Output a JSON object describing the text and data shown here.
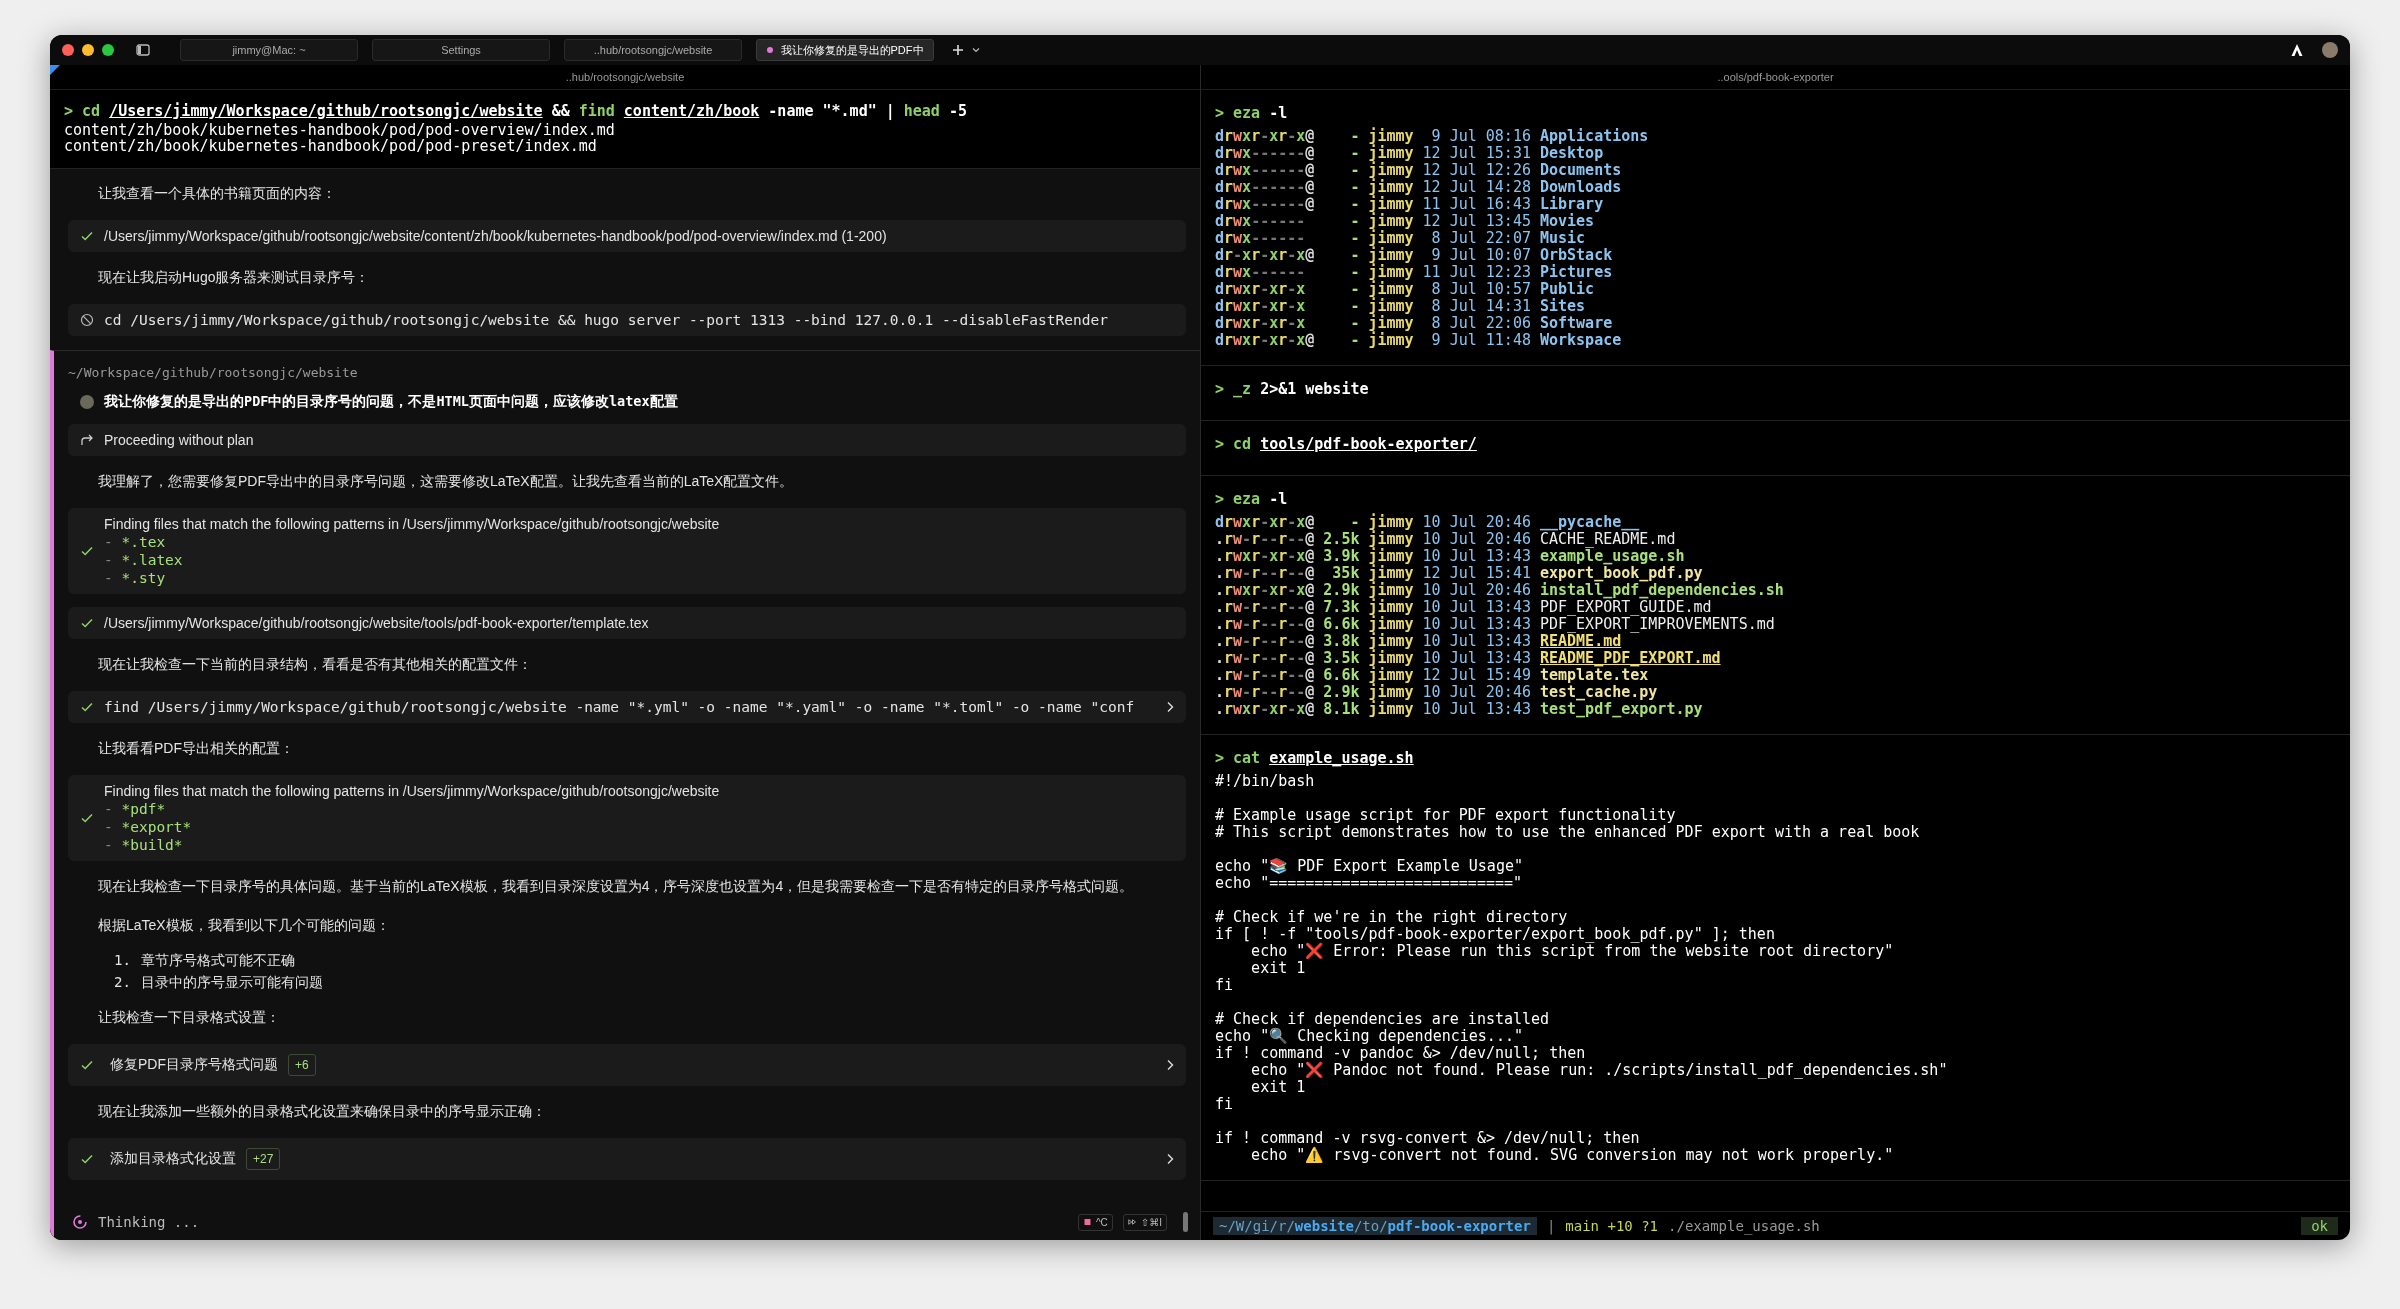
{
  "window": {
    "tabs": [
      {
        "label": "jimmy@Mac: ~",
        "selected": false
      },
      {
        "label": "Settings",
        "selected": false
      },
      {
        "label": "..hub/rootsongjc/website",
        "selected": false
      },
      {
        "label": "我让你修复的是导出的PDF中",
        "selected": true,
        "color": "#e07ad8"
      }
    ]
  },
  "left_pane": {
    "header": "..hub/rootsongjc/website",
    "command": {
      "prompt": ">",
      "segments": [
        {
          "text": "cd",
          "kind": "cmd"
        },
        {
          "text": "/Users/jimmy/Workspace/github/rootsongjc/website",
          "kind": "path"
        },
        {
          "text": "&&",
          "kind": "arg"
        },
        {
          "text": "find",
          "kind": "cmd"
        },
        {
          "text": "content/zh/book",
          "kind": "path"
        },
        {
          "text": "-name \"*.md\" |",
          "kind": "arg"
        },
        {
          "text": "head",
          "kind": "cmd"
        },
        {
          "text": "-5",
          "kind": "arg"
        }
      ]
    },
    "output": [
      "content/zh/book/kubernetes-handbook/pod/pod-overview/index.md",
      "content/zh/book/kubernetes-handbook/pod/pod-preset/index.md"
    ],
    "agent": {
      "sections": [
        {
          "highlighted": false,
          "items": [
            {
              "kind": "note",
              "text": "让我查看一个具体的书籍页面的内容："
            },
            {
              "kind": "file",
              "text": "/Users/jimmy/Workspace/github/rootsongjc/website/content/zh/book/kubernetes-handbook/pod/pod-overview/index.md (1-200)"
            },
            {
              "kind": "note",
              "text": "现在让我启动Hugo服务器来测试目录序号："
            },
            {
              "kind": "cancelled",
              "text": "cd /Users/jimmy/Workspace/github/rootsongjc/website && hugo server --port 1313 --bind 127.0.0.1 --disableFastRender"
            }
          ]
        },
        {
          "highlighted": true,
          "items": [
            {
              "kind": "path",
              "text": "~/Workspace/github/rootsongjc/website"
            },
            {
              "kind": "user",
              "text": "我让你修复的是导出的PDF中的目录序号的问题，不是HTML页面中问题，应该修改latex配置"
            },
            {
              "kind": "plan",
              "text": "Proceeding without plan"
            },
            {
              "kind": "note",
              "text": "我理解了，您需要修复PDF导出中的目录序号问题，这需要修改LaTeX配置。让我先查看当前的LaTeX配置文件。"
            },
            {
              "kind": "search",
              "text": "Finding files that match the following patterns in /Users/jimmy/Workspace/github/rootsongjc/website",
              "patterns": [
                "- *.tex",
                "- *.latex",
                "- *.sty"
              ]
            },
            {
              "kind": "file",
              "text": "/Users/jimmy/Workspace/github/rootsongjc/website/tools/pdf-book-exporter/template.tex"
            },
            {
              "kind": "note",
              "text": "现在让我检查一下当前的目录结构，看看是否有其他相关的配置文件："
            },
            {
              "kind": "command",
              "text": "find /Users/jimmy/Workspace/github/rootsongjc/website -name \"*.yml\" -o -name \"*.yaml\" -o -name \"*.toml\" -o -name \"conf"
            },
            {
              "kind": "note",
              "text": "让我看看PDF导出相关的配置："
            },
            {
              "kind": "search",
              "text": "Finding files that match the following patterns in /Users/jimmy/Workspace/github/rootsongjc/website",
              "patterns": [
                "- *pdf*",
                "- *export*",
                "- *build*"
              ]
            },
            {
              "kind": "note",
              "text": "现在让我检查一下目录序号的具体问题。基于当前的LaTeX模板，我看到目录深度设置为4，序号深度也设置为4，但是我需要检查一下是否有特定的目录序号格式问题。"
            },
            {
              "kind": "note",
              "text": "根据LaTeX模板，我看到以下几个可能的问题："
            },
            {
              "kind": "list",
              "entries": [
                {
                  "number": "1.",
                  "text": "章节序号格式可能不正确"
                },
                {
                  "number": "2.",
                  "text": "目录中的序号显示可能有问题"
                }
              ]
            },
            {
              "kind": "note",
              "text": "让我检查一下目录格式设置："
            },
            {
              "kind": "edit",
              "text": "修复PDF目录序号格式问题",
              "badge": "+6"
            },
            {
              "kind": "note",
              "text": "现在让我添加一些额外的目录格式化设置来确保目录中的序号显示正确："
            },
            {
              "kind": "edit",
              "text": "添加目录格式化设置",
              "badge": "+27"
            }
          ]
        }
      ]
    },
    "footer": {
      "status": "Thinking ...",
      "keys": [
        "^C",
        "⇧⌘I"
      ]
    }
  },
  "right_pane": {
    "header": "..ools/pdf-book-exporter",
    "blocks": [
      {
        "command": {
          "prompt": ">",
          "segments": [
            {
              "text": "eza",
              "kind": "cmd"
            },
            {
              "text": "-l",
              "kind": "arg"
            }
          ]
        },
        "listing": [
          {
            "perms": "drwxr-xr-x@",
            "size": "-",
            "user": "jimmy",
            "date": "9 Jul 08:16",
            "name": "Applications",
            "kind": "dir"
          },
          {
            "perms": "drwx------@",
            "size": "-",
            "user": "jimmy",
            "date": "12 Jul 15:31",
            "name": "Desktop",
            "kind": "dir"
          },
          {
            "perms": "drwx------@",
            "size": "-",
            "user": "jimmy",
            "date": "12 Jul 12:26",
            "name": "Documents",
            "kind": "dir"
          },
          {
            "perms": "drwx------@",
            "size": "-",
            "user": "jimmy",
            "date": "12 Jul 14:28",
            "name": "Downloads",
            "kind": "dir"
          },
          {
            "perms": "drwx------@",
            "size": "-",
            "user": "jimmy",
            "date": "11 Jul 16:43",
            "name": "Library",
            "kind": "dir"
          },
          {
            "perms": "drwx------",
            "size": "-",
            "user": "jimmy",
            "date": "12 Jul 13:45",
            "name": "Movies",
            "kind": "dir"
          },
          {
            "perms": "drwx------",
            "size": "-",
            "user": "jimmy",
            "date": "8 Jul 22:07",
            "name": "Music",
            "kind": "dir"
          },
          {
            "perms": "dr-xr-xr-x@",
            "size": "-",
            "user": "jimmy",
            "date": "9 Jul 10:07",
            "name": "OrbStack",
            "kind": "dir"
          },
          {
            "perms": "drwx------",
            "size": "-",
            "user": "jimmy",
            "date": "11 Jul 12:23",
            "name": "Pictures",
            "kind": "dir"
          },
          {
            "perms": "drwxr-xr-x",
            "size": "-",
            "user": "jimmy",
            "date": "8 Jul 10:57",
            "name": "Public",
            "kind": "dir"
          },
          {
            "perms": "drwxr-xr-x",
            "size": "-",
            "user": "jimmy",
            "date": "8 Jul 14:31",
            "name": "Sites",
            "kind": "dir"
          },
          {
            "perms": "drwxr-xr-x",
            "size": "-",
            "user": "jimmy",
            "date": "8 Jul 22:06",
            "name": "Software",
            "kind": "dir"
          },
          {
            "perms": "drwxr-xr-x@",
            "size": "-",
            "user": "jimmy",
            "date": "9 Jul 11:48",
            "name": "Workspace",
            "kind": "dir"
          }
        ]
      },
      {
        "command": {
          "prompt": ">",
          "segments": [
            {
              "text": "_z",
              "kind": "cmd"
            },
            {
              "text": "2>&1 website",
              "kind": "arg"
            }
          ]
        }
      },
      {
        "command": {
          "prompt": ">",
          "segments": [
            {
              "text": "cd",
              "kind": "cmd"
            },
            {
              "text": "tools/pdf-book-exporter/",
              "kind": "path"
            }
          ]
        }
      },
      {
        "command": {
          "prompt": ">",
          "segments": [
            {
              "text": "eza",
              "kind": "cmd"
            },
            {
              "text": "-l",
              "kind": "arg"
            }
          ]
        },
        "listing": [
          {
            "perms": "drwxr-xr-x@",
            "size": "-",
            "user": "jimmy",
            "date": "10 Jul 20:46",
            "name": "__pycache__",
            "kind": "dir"
          },
          {
            "perms": ".rw-r--r--@",
            "size": "2.5k",
            "user": "jimmy",
            "date": "10 Jul 20:46",
            "name": "CACHE_README.md",
            "kind": "plain"
          },
          {
            "perms": ".rwxr-xr-x@",
            "size": "3.9k",
            "user": "jimmy",
            "date": "10 Jul 13:43",
            "name": "example_usage.sh",
            "kind": "exec"
          },
          {
            "perms": ".rw-r--r--@",
            "size": "35k",
            "user": "jimmy",
            "date": "12 Jul 15:41",
            "name": "export_book_pdf.py",
            "kind": "source"
          },
          {
            "perms": ".rwxr-xr-x@",
            "size": "2.9k",
            "user": "jimmy",
            "date": "10 Jul 20:46",
            "name": "install_pdf_dependencies.sh",
            "kind": "exec"
          },
          {
            "perms": ".rw-r--r--@",
            "size": "7.3k",
            "user": "jimmy",
            "date": "10 Jul 13:43",
            "name": "PDF_EXPORT_GUIDE.md",
            "kind": "plain"
          },
          {
            "perms": ".rw-r--r--@",
            "size": "6.6k",
            "user": "jimmy",
            "date": "10 Jul 13:43",
            "name": "PDF_EXPORT_IMPROVEMENTS.md",
            "kind": "plain"
          },
          {
            "perms": ".rw-r--r--@",
            "size": "3.8k",
            "user": "jimmy",
            "date": "10 Jul 13:43",
            "name": "README.md",
            "kind": "readme"
          },
          {
            "perms": ".rw-r--r--@",
            "size": "3.5k",
            "user": "jimmy",
            "date": "10 Jul 13:43",
            "name": "README_PDF_EXPORT.md",
            "kind": "readme"
          },
          {
            "perms": ".rw-r--r--@",
            "size": "6.6k",
            "user": "jimmy",
            "date": "12 Jul 15:49",
            "name": "template.tex",
            "kind": "source"
          },
          {
            "perms": ".rw-r--r--@",
            "size": "2.9k",
            "user": "jimmy",
            "date": "10 Jul 20:46",
            "name": "test_cache.py",
            "kind": "source"
          },
          {
            "perms": ".rwxr-xr-x@",
            "size": "8.1k",
            "user": "jimmy",
            "date": "10 Jul 13:43",
            "name": "test_pdf_export.py",
            "kind": "exec"
          }
        ]
      },
      {
        "command": {
          "prompt": ">",
          "segments": [
            {
              "text": "cat",
              "kind": "cmd"
            },
            {
              "text": "example_usage.sh",
              "kind": "path"
            }
          ]
        },
        "code": "#!/bin/bash\n\n# Example usage script for PDF export functionality\n# This script demonstrates how to use the enhanced PDF export with a real book\n\necho \"📚 PDF Export Example Usage\"\necho \"===========================\"\n\n# Check if we're in the right directory\nif [ ! -f \"tools/pdf-book-exporter/export_book_pdf.py\" ]; then\n    echo \"❌ Error: Please run this script from the website root directory\"\n    exit 1\nfi\n\n# Check if dependencies are installed\necho \"🔍 Checking dependencies...\"\nif ! command -v pandoc &> /dev/null; then\n    echo \"❌ Pandoc not found. Please run: ./scripts/install_pdf_dependencies.sh\"\n    exit 1\nfi\n\nif ! command -v rsvg-convert &> /dev/null; then\n    echo \"⚠️ rsvg-convert not found. SVG conversion may not work properly.\""
      }
    ],
    "prompt_bar": {
      "path": [
        {
          "text": "~/W/gi/r/",
          "bright": false
        },
        {
          "text": "website",
          "bright": true
        },
        {
          "text": "/to/",
          "bright": false
        },
        {
          "text": "pdf-book-exporter",
          "bright": true
        }
      ],
      "separator": "|",
      "git": "main +10 ?1",
      "command": "./example_usage.sh",
      "status": "ok"
    }
  }
}
